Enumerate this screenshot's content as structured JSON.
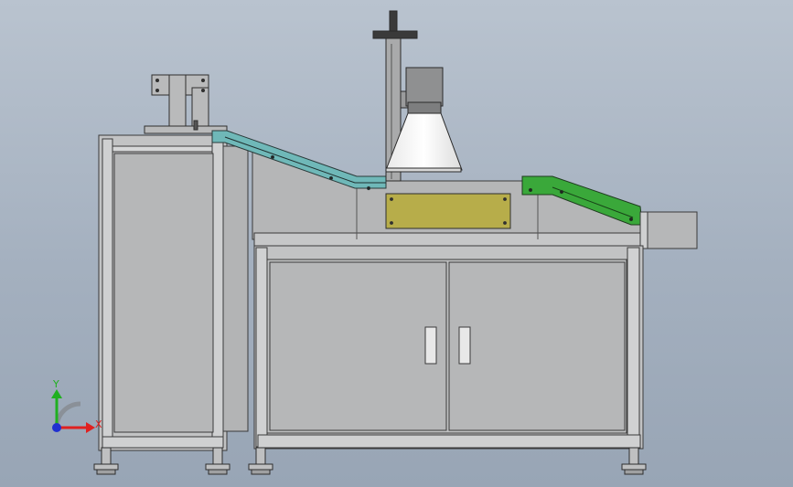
{
  "viewport": {
    "background_top": "#b9c3cf",
    "background_bottom": "#98a5b5"
  },
  "colors": {
    "frame": "#c2c3c4",
    "frame_edge": "#3a3a3a",
    "panel": "#b4b5b6",
    "cabinet": "#bcbdbe",
    "teal_conveyor": "#6fb8b8",
    "green_conveyor": "#3aa83a",
    "yellow_panel": "#b7ad4a",
    "lamp_shade": "#f4f4f4"
  },
  "axis_triad": {
    "x_label": "X",
    "y_label": "Y",
    "x_color": "#e02020",
    "y_color": "#20b020",
    "z_color": "#2030d0"
  }
}
